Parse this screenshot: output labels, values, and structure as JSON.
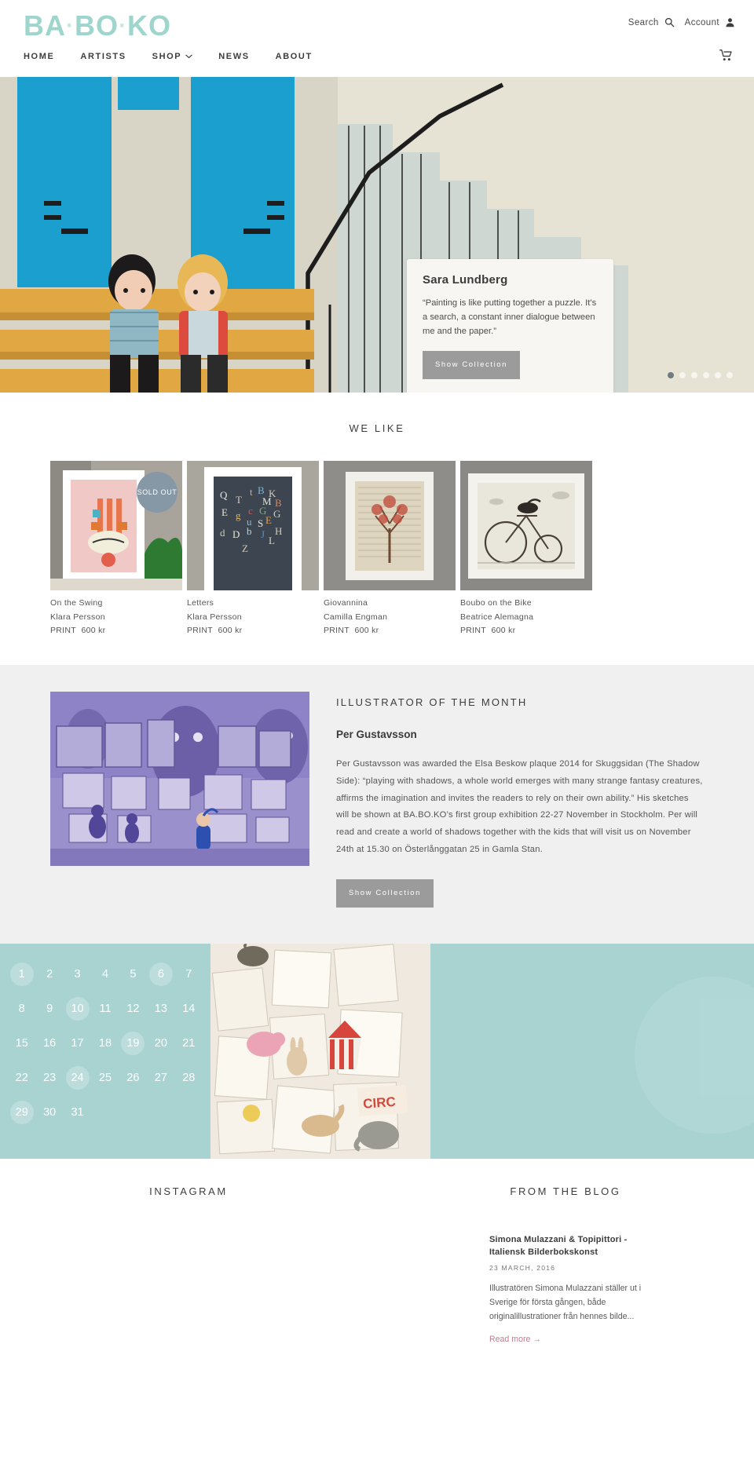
{
  "brand": {
    "part1": "BA",
    "sep1": "·",
    "part2": "BO",
    "sep2": "·",
    "part3": "KO",
    "color": "#9ed5cc"
  },
  "header": {
    "search_label": "Search",
    "account_label": "Account",
    "search_icon": "search-icon",
    "account_icon": "person-icon",
    "cart_icon": "cart-icon"
  },
  "nav": {
    "items": [
      {
        "label": "HOME"
      },
      {
        "label": "ARTISTS"
      },
      {
        "label": "SHOP",
        "caret": "⌄"
      },
      {
        "label": "NEWS"
      },
      {
        "label": "ABOUT"
      }
    ]
  },
  "hero": {
    "artist": "Sara Lundberg",
    "quote": "“Painting is like putting together a puzzle. It’s a search, a constant inner dialogue between me and the paper.”",
    "button": "Show Collection",
    "dots_count": 6,
    "active_dot": 0
  },
  "we_like": {
    "title": "WE LIKE",
    "products": [
      {
        "title": "On the Swing",
        "artist": "Klara Persson",
        "type": "PRINT",
        "price": "600 kr",
        "badge": "SOLD OUT"
      },
      {
        "title": "Letters",
        "artist": "Klara Persson",
        "type": "PRINT",
        "price": "600 kr",
        "badge": ""
      },
      {
        "title": "Giovannina",
        "artist": "Camilla Engman",
        "type": "PRINT",
        "price": "600 kr",
        "badge": ""
      },
      {
        "title": "Boubo on the Bike",
        "artist": "Beatrice Alemagna",
        "type": "PRINT",
        "price": "600 kr",
        "badge": ""
      }
    ]
  },
  "illustrator": {
    "section_title": "ILLUSTRATOR OF THE MONTH",
    "name": "Per Gustavsson",
    "body": "Per Gustavsson was awarded the Elsa Beskow plaque 2014 for Skuggsidan (The Shadow Side): “playing with shadows, a whole world emerges with many strange fantasy creatures, affirms the imagination and invites the readers to rely on their own ability.” His sketches will be shown at BA.BO.KO’s first group exhibition 22-27 November in Stockholm. Per will read and create a world of shadows together with the kids that will visit us on November 24th at 15.30 on Österlånggatan 25 in Gamla Stan.",
    "button": "Show Collection"
  },
  "calendar": {
    "days": [
      1,
      2,
      3,
      4,
      5,
      6,
      7,
      8,
      9,
      10,
      11,
      12,
      13,
      14,
      15,
      16,
      17,
      18,
      19,
      20,
      21,
      22,
      23,
      24,
      25,
      26,
      27,
      28,
      29,
      30,
      31
    ],
    "highlighted": [
      1,
      6,
      10,
      19,
      24,
      29
    ],
    "background": "#a8d3d1"
  },
  "bottom": {
    "instagram_title": "INSTAGRAM",
    "blog_title": "FROM THE BLOG",
    "post": {
      "title": "Simona Mulazzani & Topipittori - Italiensk Bilderbokskonst",
      "date": "23 MARCH, 2016",
      "excerpt": "Illustratören Simona Mulazzani ställer ut i Sverige för första gången, både originalillustrationer från hennes bilde...",
      "read_more": "Read more →"
    }
  }
}
